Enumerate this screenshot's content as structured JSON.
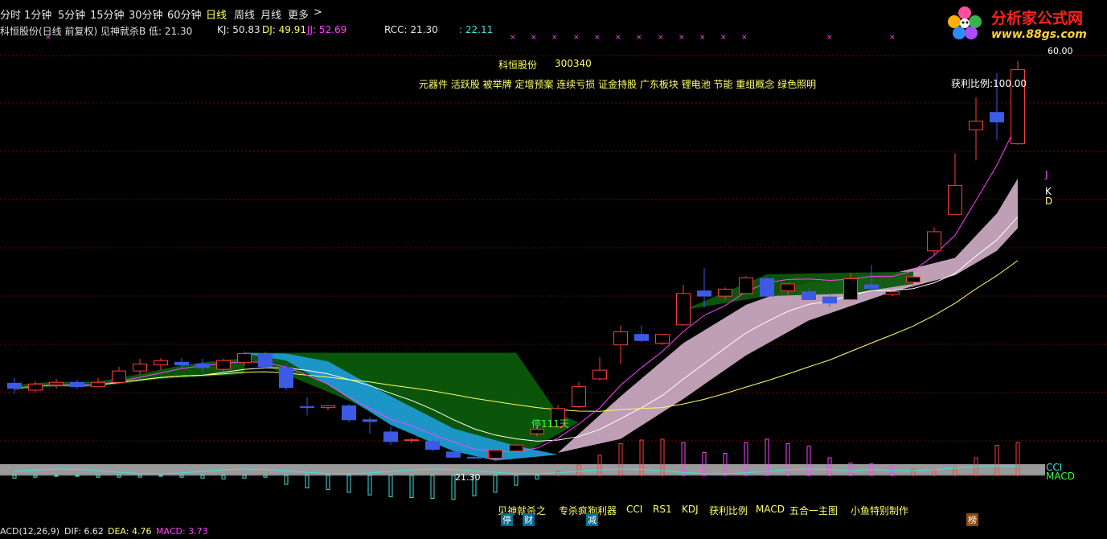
{
  "toolbar": {
    "timeframes": [
      "分时",
      "1分钟",
      "5分钟",
      "15分钟",
      "30分钟",
      "60分钟",
      "日线",
      "周线",
      "月线",
      "更多"
    ],
    "active": "日线",
    "more_arrow": ">"
  },
  "logo": {
    "text": "分析家公式网",
    "url": "www.88gs.com"
  },
  "infobar": {
    "title": "科恒股份(日线 前复权) 见神就杀B 低: 21.30",
    "kj": "KJ: 50.83",
    "dj": "DJ: 49.91",
    "jj": "JJ: 52.69",
    "rcc": "RCC: 21.30",
    "last": ": 22.11"
  },
  "stock": {
    "name": "科恒股份",
    "code": "300340"
  },
  "concepts": "元器件 活跃股 被举牌 定增预案 连续亏损 证金持股 广东板块 锂电池 节能 重组概念 绿色照明",
  "profit_ratio": "获利比例:100.00",
  "labels": {
    "j": "J",
    "k": "K",
    "d": "D",
    "high_price": "60.00",
    "low_price": "21.30",
    "stop_days": "停111天",
    "cci": "CCI",
    "macd": "MACD"
  },
  "signals": {
    "ting": "停",
    "cai": "财",
    "jian": "减",
    "bang": "榜"
  },
  "bottom_tabs": [
    "见神就杀之",
    "专杀疯狗利器",
    "CCI",
    "RS1",
    "KDJ",
    "获利比例",
    "MACD",
    "五合一主图",
    "小鱼特别制作"
  ],
  "macd_bar": {
    "name": "ACD(12,26,9)",
    "dif": "DIF: 6.62",
    "dea": "DEA: 4.76",
    "macd": "MACD: 3.73"
  },
  "colors": {
    "up": "#ff3c3c",
    "down": "#3c5ae6",
    "green_cloud": "#0b5a0b",
    "blue_cloud": "#1e9ad2",
    "pink_band": "#c8a8c0",
    "yellow": "#ffff66",
    "magenta": "#ff40ff",
    "cyan": "#40e0e0"
  },
  "chart_data": {
    "type": "candlestick",
    "price_range": [
      21.3,
      60.0
    ],
    "candles": [
      {
        "o": 24.0,
        "h": 24.6,
        "l": 22.8,
        "c": 23.4
      },
      {
        "o": 23.2,
        "h": 24.2,
        "l": 22.9,
        "c": 23.9
      },
      {
        "o": 23.8,
        "h": 24.5,
        "l": 23.4,
        "c": 24.1
      },
      {
        "o": 24.1,
        "h": 24.4,
        "l": 23.3,
        "c": 23.6
      },
      {
        "o": 23.6,
        "h": 24.6,
        "l": 23.5,
        "c": 24.1
      },
      {
        "o": 24.1,
        "h": 25.9,
        "l": 23.9,
        "c": 25.4
      },
      {
        "o": 25.4,
        "h": 26.8,
        "l": 25.0,
        "c": 26.2
      },
      {
        "o": 26.1,
        "h": 26.9,
        "l": 25.5,
        "c": 26.6
      },
      {
        "o": 26.4,
        "h": 26.9,
        "l": 25.8,
        "c": 26.1
      },
      {
        "o": 26.2,
        "h": 26.8,
        "l": 25.2,
        "c": 25.8
      },
      {
        "o": 25.6,
        "h": 26.8,
        "l": 25.3,
        "c": 26.6
      },
      {
        "o": 26.4,
        "h": 27.6,
        "l": 26.0,
        "c": 27.4
      },
      {
        "o": 27.4,
        "h": 27.6,
        "l": 25.7,
        "c": 25.9
      },
      {
        "o": 25.8,
        "h": 26.2,
        "l": 23.2,
        "c": 23.5
      },
      {
        "o": 21.3,
        "h": 22.4,
        "l": 20.3,
        "c": 21.2
      },
      {
        "o": 21.2,
        "h": 21.5,
        "l": 20.9,
        "c": 21.4
      },
      {
        "o": 21.4,
        "h": 21.6,
        "l": 19.5,
        "c": 19.8
      },
      {
        "o": 19.8,
        "h": 20.1,
        "l": 18.2,
        "c": 19.6
      },
      {
        "o": 18.4,
        "h": 19.0,
        "l": 16.9,
        "c": 17.3
      },
      {
        "o": 17.4,
        "h": 17.7,
        "l": 17.1,
        "c": 17.5
      },
      {
        "o": 17.3,
        "h": 17.6,
        "l": 16.2,
        "c": 16.4
      },
      {
        "o": 16.1,
        "h": 16.3,
        "l": 15.4,
        "c": 15.5
      },
      {
        "o": 15.5,
        "h": 15.6,
        "l": 15.4,
        "c": 15.4
      },
      {
        "o": 15.4,
        "h": 16.4,
        "l": 15.2,
        "c": 16.3
      },
      {
        "o": 16.2,
        "h": 17.0,
        "l": 16.1,
        "c": 16.9
      },
      {
        "o": 18.2,
        "h": 19.1,
        "l": 17.9,
        "c": 18.7
      },
      {
        "o": 19.0,
        "h": 21.5,
        "l": 18.8,
        "c": 21.1
      },
      {
        "o": 21.3,
        "h": 24.1,
        "l": 21.1,
        "c": 23.6
      },
      {
        "o": 24.5,
        "h": 27.0,
        "l": 24.3,
        "c": 25.5
      },
      {
        "o": 28.4,
        "h": 30.6,
        "l": 26.2,
        "c": 29.9
      },
      {
        "o": 29.6,
        "h": 30.6,
        "l": 28.7,
        "c": 28.9
      },
      {
        "o": 28.6,
        "h": 29.7,
        "l": 28.4,
        "c": 29.6
      },
      {
        "o": 30.7,
        "h": 35.3,
        "l": 30.6,
        "c": 34.3
      },
      {
        "o": 34.6,
        "h": 37.2,
        "l": 32.7,
        "c": 34.0
      },
      {
        "o": 34.0,
        "h": 35.0,
        "l": 33.6,
        "c": 34.8
      },
      {
        "o": 34.3,
        "h": 36.3,
        "l": 34.3,
        "c": 36.1
      },
      {
        "o": 36.0,
        "h": 36.2,
        "l": 33.8,
        "c": 34.0
      },
      {
        "o": 34.6,
        "h": 35.5,
        "l": 34.0,
        "c": 35.4
      },
      {
        "o": 34.5,
        "h": 34.9,
        "l": 33.6,
        "c": 33.6
      },
      {
        "o": 33.9,
        "h": 34.1,
        "l": 32.8,
        "c": 33.2
      },
      {
        "o": 33.6,
        "h": 36.7,
        "l": 33.5,
        "c": 36.0
      },
      {
        "o": 35.3,
        "h": 37.6,
        "l": 34.8,
        "c": 34.9
      },
      {
        "o": 34.2,
        "h": 34.7,
        "l": 34.0,
        "c": 34.5
      },
      {
        "o": 35.6,
        "h": 36.3,
        "l": 35.0,
        "c": 36.2
      },
      {
        "o": 39.2,
        "h": 41.9,
        "l": 38.8,
        "c": 41.4
      },
      {
        "o": 43.4,
        "h": 50.4,
        "l": 43.4,
        "c": 46.7
      },
      {
        "o": 53.1,
        "h": 56.8,
        "l": 49.6,
        "c": 54.1
      },
      {
        "o": 55.1,
        "h": 59.6,
        "l": 51.9,
        "c": 54.0
      },
      {
        "o": 51.5,
        "h": 61.0,
        "l": 51.4,
        "c": 60.0
      }
    ],
    "macd_hist": [
      -0.3,
      -0.2,
      -0.1,
      -0.1,
      -0.2,
      -0.2,
      -0.2,
      -0.1,
      -0.2,
      -0.3,
      -0.4,
      -0.3,
      -0.2,
      -1.0,
      -1.4,
      -1.6,
      -1.9,
      -2.2,
      -2.4,
      -2.5,
      -2.6,
      -2.7,
      -2.3,
      -1.9,
      -1.1,
      -0.4,
      0.4,
      1.2,
      2.3,
      3.6,
      4.0,
      4.1,
      3.7,
      2.6,
      2.5,
      3.7,
      4.1,
      3.6,
      3.3,
      2.0,
      1.4,
      1.3,
      1.1,
      0.7,
      0.7,
      0.9,
      2.0,
      3.4,
      3.73
    ]
  }
}
